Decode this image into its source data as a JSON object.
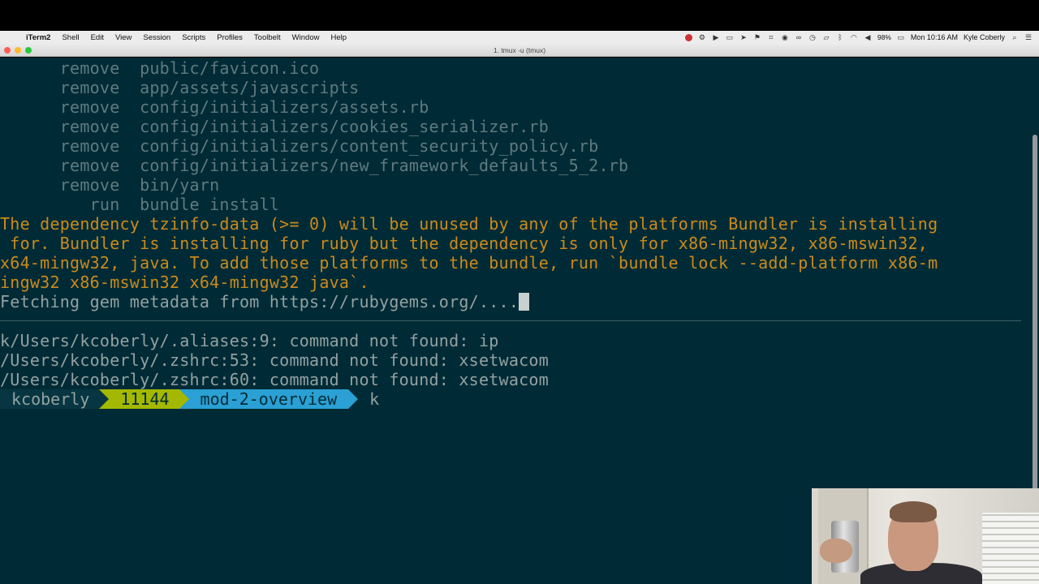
{
  "menubar": {
    "app_name": "iTerm2",
    "items": [
      "Shell",
      "Edit",
      "View",
      "Session",
      "Scripts",
      "Profiles",
      "Toolbelt",
      "Window",
      "Help"
    ],
    "battery": "98%",
    "clock": "Mon 10:16 AM",
    "user": "Kyle Coberly"
  },
  "window": {
    "title": "1. tmux -u (tmux)"
  },
  "terminal": {
    "lines": [
      {
        "text": "      remove  public/favicon.ico",
        "style": "dim"
      },
      {
        "text": "      remove  app/assets/javascripts",
        "style": "dim"
      },
      {
        "text": "      remove  config/initializers/assets.rb",
        "style": "dim"
      },
      {
        "text": "      remove  config/initializers/cookies_serializer.rb",
        "style": "dim"
      },
      {
        "text": "      remove  config/initializers/content_security_policy.rb",
        "style": "dim"
      },
      {
        "text": "      remove  config/initializers/new_framework_defaults_5_2.rb",
        "style": "dim"
      },
      {
        "text": "      remove  bin/yarn",
        "style": "dim"
      },
      {
        "text": "         run  bundle install",
        "style": "dim"
      },
      {
        "text": "The dependency tzinfo-data (>= 0) will be unused by any of the platforms Bundler is installing",
        "style": "warn"
      },
      {
        "text": " for. Bundler is installing for ruby but the dependency is only for x86-mingw32, x86-mswin32,",
        "style": "warn"
      },
      {
        "text": "x64-mingw32, java. To add those platforms to the bundle, run `bundle lock --add-platform x86-m",
        "style": "warn"
      },
      {
        "text": "ingw32 x86-mswin32 x64-mingw32 java`.",
        "style": "warn"
      },
      {
        "text": "Fetching gem metadata from https://rubygems.org/....",
        "style": "text"
      }
    ],
    "lower_lines": [
      "k/Users/kcoberly/.aliases:9: command not found: ip",
      "/Users/kcoberly/.zshrc:53: command not found: xsetwacom",
      "/Users/kcoberly/.zshrc:60: command not found: xsetwacom"
    ],
    "prompt": {
      "user": "kcoberly",
      "history_number": "11144",
      "branch": "mod-2-overview",
      "typed": "k"
    }
  },
  "colors": {
    "background": "#002b36",
    "warning": "#cb8a1c",
    "prompt_number_bg": "#a4b800",
    "prompt_branch_bg": "#2aa0d4"
  }
}
